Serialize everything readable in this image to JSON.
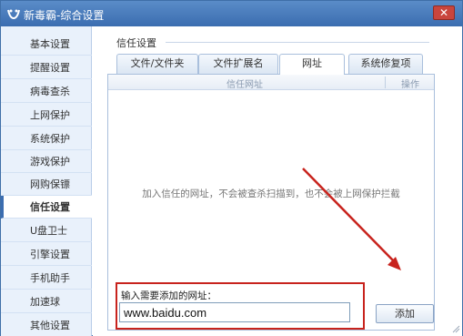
{
  "window": {
    "title": "新毒霸-综合设置",
    "close_label": "✕",
    "colors": {
      "titlebar": "#3b6db0",
      "highlight": "#c8231d",
      "arrow": "#c8231d"
    }
  },
  "sidebar": {
    "items": [
      {
        "label": "基本设置"
      },
      {
        "label": "提醒设置"
      },
      {
        "label": "病毒查杀"
      },
      {
        "label": "上网保护"
      },
      {
        "label": "系统保护"
      },
      {
        "label": "游戏保护"
      },
      {
        "label": "网购保镖"
      },
      {
        "label": "信任设置",
        "active": true
      },
      {
        "label": "U盘卫士"
      },
      {
        "label": "引擎设置"
      },
      {
        "label": "手机助手"
      },
      {
        "label": "加速球"
      },
      {
        "label": "其他设置"
      }
    ]
  },
  "trust": {
    "group_title": "信任设置",
    "tabs": [
      {
        "label": "文件/文件夹"
      },
      {
        "label": "文件扩展名"
      },
      {
        "label": "网址",
        "active": true
      },
      {
        "label": "系统修复项"
      }
    ],
    "table": {
      "col_url": "信任网址",
      "col_action": "操作"
    },
    "empty_message": "加入信任的网址，不会被查杀扫描到，也不会被上网保护拦截",
    "input_label": "输入需要添加的网址：",
    "input_value": "www.baidu.com",
    "add_button": "添加"
  },
  "icons": {
    "logo": "duba-logo-icon",
    "close": "close-icon"
  }
}
